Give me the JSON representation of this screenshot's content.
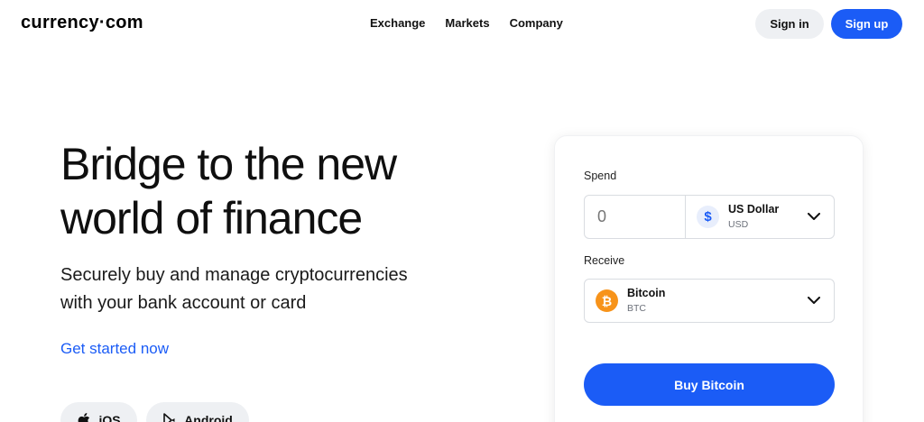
{
  "header": {
    "logo": "currency·com",
    "nav": [
      "Exchange",
      "Markets",
      "Company"
    ],
    "signin_label": "Sign in",
    "signup_label": "Sign up"
  },
  "hero": {
    "title_line1": "Bridge to the new",
    "title_line2": "world of finance",
    "subtitle_line1": "Securely buy and manage cryptocurrencies",
    "subtitle_line2": "with your bank account or card",
    "cta": "Get started now",
    "stores": [
      {
        "label": "iOS",
        "icon": "apple-icon"
      },
      {
        "label": "Android",
        "icon": "play-store-icon"
      }
    ]
  },
  "widget": {
    "spend_label": "Spend",
    "amount_placeholder": "0",
    "spend_currency": {
      "name": "US Dollar",
      "code": "USD",
      "icon": "dollar-icon"
    },
    "receive_label": "Receive",
    "receive_currency": {
      "name": "Bitcoin",
      "code": "BTC",
      "icon": "bitcoin-icon"
    },
    "buy_label": "Buy Bitcoin"
  },
  "colors": {
    "accent": "#1b5cf6",
    "bitcoin": "#f7931a",
    "button_secondary": "#eef0f3"
  }
}
